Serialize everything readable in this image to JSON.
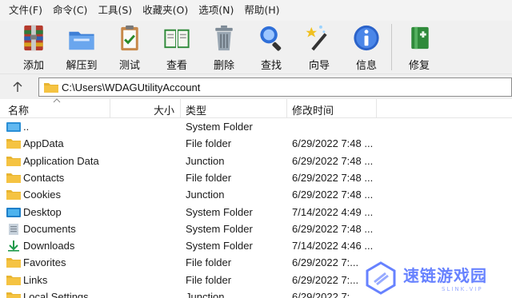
{
  "menu": [
    "文件(F)",
    "命令(C)",
    "工具(S)",
    "收藏夹(O)",
    "选项(N)",
    "帮助(H)"
  ],
  "toolbar": [
    {
      "label": "添加",
      "icon": "add-archive-icon"
    },
    {
      "label": "解压到",
      "icon": "extract-folder-icon"
    },
    {
      "label": "测试",
      "icon": "test-clipboard-icon"
    },
    {
      "label": "查看",
      "icon": "view-book-icon"
    },
    {
      "label": "删除",
      "icon": "delete-trash-icon"
    },
    {
      "label": "查找",
      "icon": "find-magnifier-icon"
    },
    {
      "label": "向导",
      "icon": "wizard-wand-icon"
    },
    {
      "label": "信息",
      "icon": "info-icon"
    },
    {
      "label": "修复",
      "icon": "repair-kit-icon"
    }
  ],
  "address": {
    "path": "C:\\Users\\WDAGUtilityAccount"
  },
  "columns": {
    "name": "名称",
    "size": "大小",
    "type": "类型",
    "modified": "修改时间"
  },
  "rows": [
    {
      "name": "..",
      "type": "System Folder",
      "modified": "",
      "icon": "parent-folder-icon"
    },
    {
      "name": "AppData",
      "type": "File folder",
      "modified": "6/29/2022 7:48 ...",
      "icon": "folder-icon"
    },
    {
      "name": "Application Data",
      "type": "Junction",
      "modified": "6/29/2022 7:48 ...",
      "icon": "folder-icon"
    },
    {
      "name": "Contacts",
      "type": "File folder",
      "modified": "6/29/2022 7:48 ...",
      "icon": "folder-icon"
    },
    {
      "name": "Cookies",
      "type": "Junction",
      "modified": "6/29/2022 7:48 ...",
      "icon": "folder-icon"
    },
    {
      "name": "Desktop",
      "type": "System Folder",
      "modified": "7/14/2022 4:49 ...",
      "icon": "desktop-folder-icon"
    },
    {
      "name": "Documents",
      "type": "System Folder",
      "modified": "6/29/2022 7:48 ...",
      "icon": "documents-folder-icon"
    },
    {
      "name": "Downloads",
      "type": "System Folder",
      "modified": "7/14/2022 4:46 ...",
      "icon": "downloads-folder-icon"
    },
    {
      "name": "Favorites",
      "type": "File folder",
      "modified": "6/29/2022 7:...",
      "icon": "folder-icon"
    },
    {
      "name": "Links",
      "type": "File folder",
      "modified": "6/29/2022 7:...",
      "icon": "folder-icon"
    },
    {
      "name": "Local Settings",
      "type": "Junction",
      "modified": "6/29/2022 7:...",
      "icon": "folder-icon"
    }
  ],
  "watermark": {
    "main": "速链游戏园",
    "sub": "SLINK.VIP"
  },
  "colors": {
    "folder": "#f5c342",
    "accent": "#5b78ff",
    "menubar": "#f3f3f3",
    "toolbar": "#f0f0f0"
  }
}
